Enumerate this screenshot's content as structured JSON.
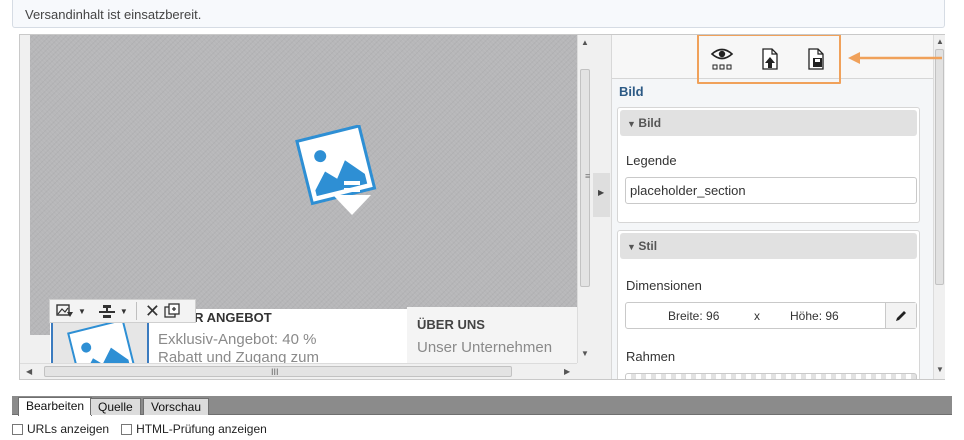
{
  "status": {
    "message": "Versandinhalt ist einsatzbereit."
  },
  "canvas": {
    "toolbar": {
      "icons": [
        "insert-image-icon",
        "dropdown-arrow-icon",
        "layout-icon",
        "dropdown-arrow-icon",
        "delete-icon",
        "copy-icon"
      ]
    },
    "offer": {
      "title": "UNSER ANGEBOT",
      "line1": "Exklusiv-Angebot: 40 %",
      "line2": "Rabatt und Zugang zum"
    },
    "about": {
      "title": "ÜBER UNS",
      "text": "Unser Unternehmen"
    },
    "hscroll_grip": "III",
    "vscroll_grip": "≡"
  },
  "panel": {
    "title": "Bild",
    "section_image": {
      "header": "Bild",
      "caption_label": "Legende",
      "caption_value": "placeholder_section"
    },
    "section_style": {
      "header": "Stil",
      "dimensions_label": "Dimensionen",
      "width_text": "Breite: 96",
      "x_text": "x",
      "height_text": "Höhe: 96",
      "border_label": "Rahmen"
    }
  },
  "bottom": {
    "tabs": [
      "Bearbeiten",
      "Quelle",
      "Vorschau"
    ],
    "active_tab": "Bearbeiten",
    "checkbox_urls": "URLs anzeigen",
    "checkbox_html": "HTML-Prüfung anzeigen"
  },
  "colors": {
    "highlight": "#f0a15a",
    "panel_title": "#2c5a85",
    "image_blue": "#2e8fd4"
  }
}
